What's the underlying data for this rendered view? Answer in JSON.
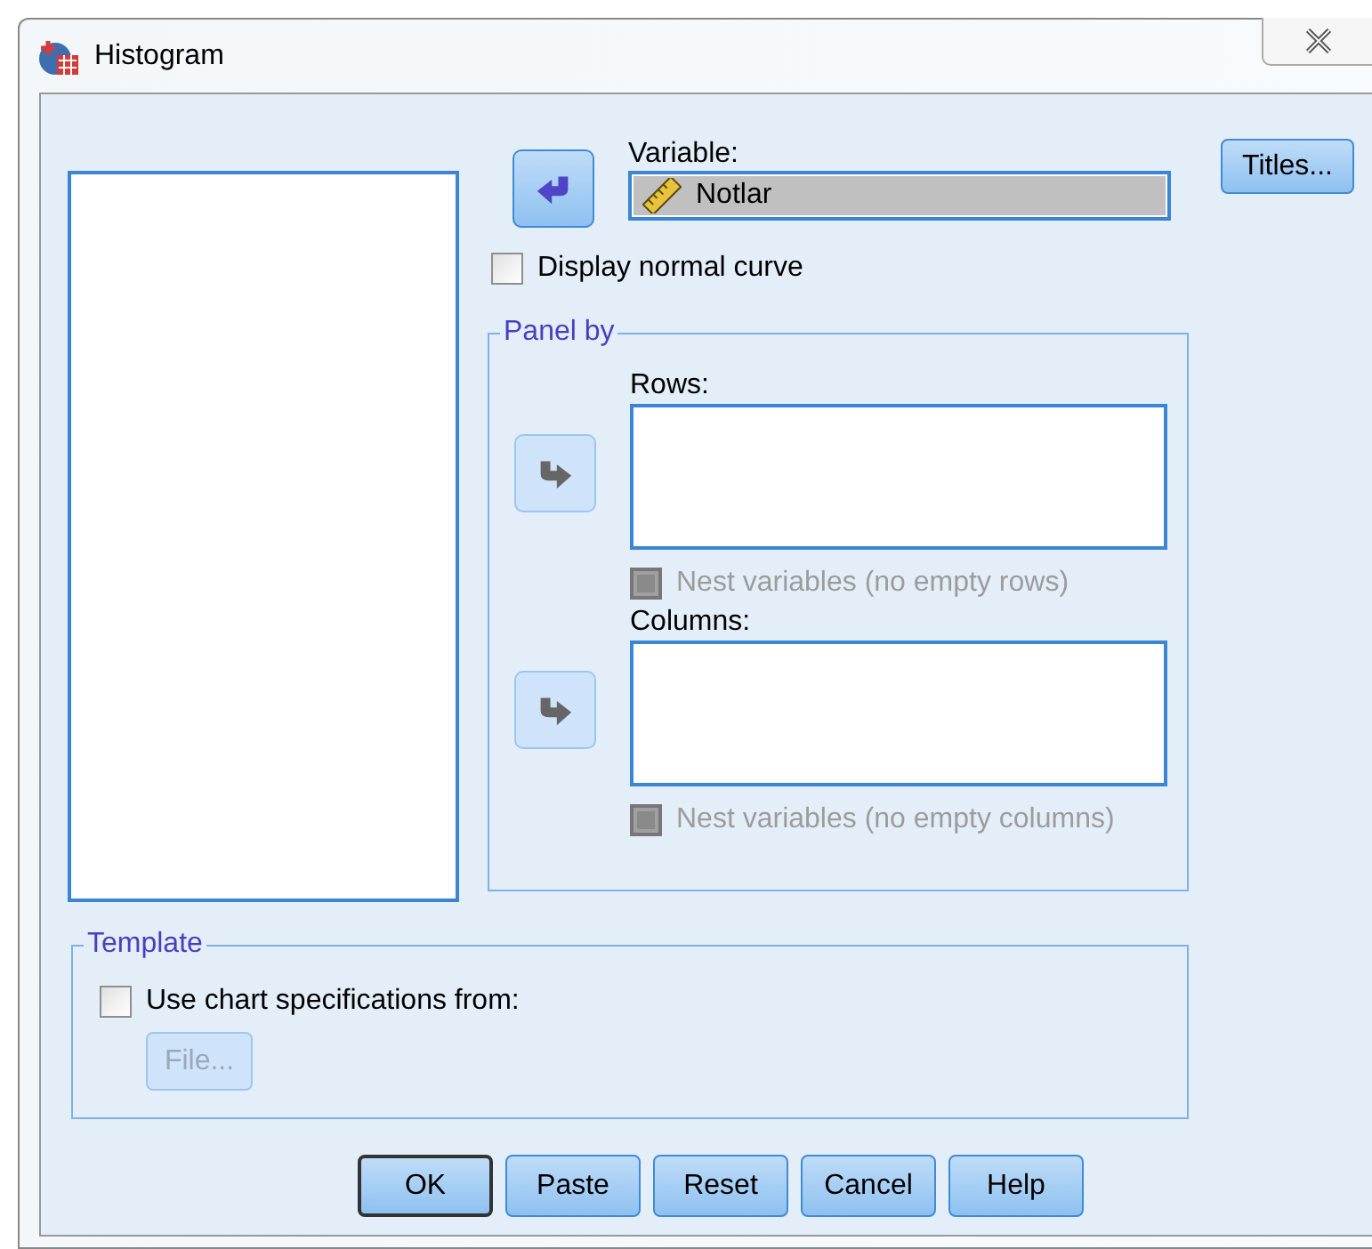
{
  "window": {
    "title": "Histogram"
  },
  "variable": {
    "label": "Variable:",
    "value": "Notlar",
    "move_button": {
      "kind": "left",
      "disabled": false
    }
  },
  "display_normal_curve": {
    "label": "Display normal curve",
    "checked": false
  },
  "panel_by": {
    "title": "Panel by",
    "sections": [
      {
        "label": "Rows:",
        "move_button": {
          "kind": "right",
          "disabled": true
        },
        "nest": {
          "label": "Nest variables (no empty rows)",
          "checked": false,
          "disabled": true
        }
      },
      {
        "label": "Columns:",
        "move_button": {
          "kind": "right",
          "disabled": true
        },
        "nest": {
          "label": "Nest variables (no empty columns)",
          "checked": false,
          "disabled": true
        }
      }
    ]
  },
  "template": {
    "title": "Template",
    "option": {
      "label": "Use chart specifications from:",
      "checked": false
    },
    "file_button": {
      "label": "File...",
      "disabled": true
    }
  },
  "side_buttons": [
    {
      "label": "Titles...",
      "disabled": false
    }
  ],
  "buttons": [
    {
      "label": "OK",
      "default": true
    },
    {
      "label": "Paste",
      "default": false
    },
    {
      "label": "Reset",
      "default": false
    },
    {
      "label": "Cancel",
      "default": false
    },
    {
      "label": "Help",
      "default": false
    }
  ]
}
